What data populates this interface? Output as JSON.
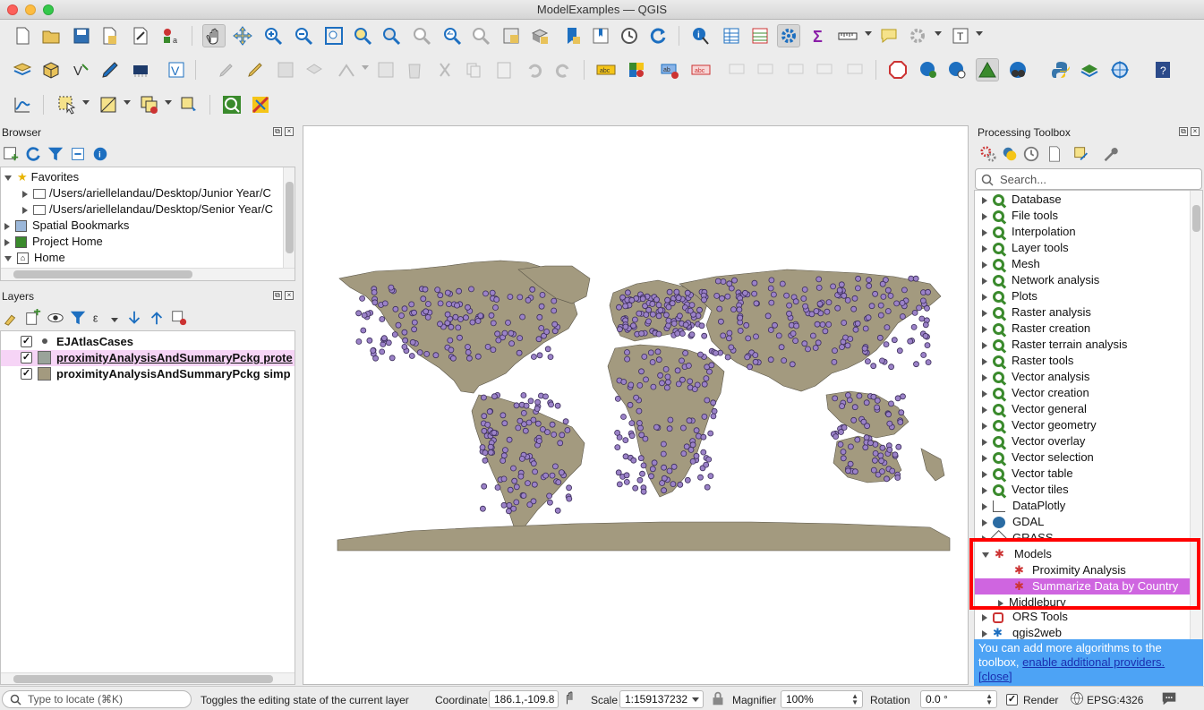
{
  "window": {
    "title": "ModelExamples — QGIS"
  },
  "colors": {
    "selection": "#cf65e0",
    "ocean": "#ffffff",
    "land": "#a39a7f",
    "point": "#9b82c8",
    "highlight_box": "#ff0000",
    "tip_bg": "#4da3f5"
  },
  "browser": {
    "title": "Browser",
    "items": [
      {
        "label": "Favorites",
        "expanded": true,
        "icon": "star-icon"
      },
      {
        "label": "/Users/ariellelandau/Desktop/Junior Year/C",
        "icon": "folder-icon"
      },
      {
        "label": "/Users/ariellelandau/Desktop/Senior Year/C",
        "icon": "folder-icon"
      },
      {
        "label": "Spatial Bookmarks",
        "icon": "bookmark-icon"
      },
      {
        "label": "Project Home",
        "icon": "project-home-icon"
      },
      {
        "label": "Home",
        "icon": "home-icon"
      }
    ]
  },
  "layers": {
    "title": "Layers",
    "items": [
      {
        "label": "EJAtlasCases",
        "checked": true
      },
      {
        "label": "proximityAnalysisAndSummaryPckg prote",
        "checked": true
      },
      {
        "label": "proximityAnalysisAndSummaryPckg simp",
        "checked": true
      }
    ]
  },
  "toolbox": {
    "title": "Processing Toolbox",
    "search_placeholder": "Search...",
    "providers": [
      "Database",
      "File tools",
      "Interpolation",
      "Layer tools",
      "Mesh",
      "Network analysis",
      "Plots",
      "Raster analysis",
      "Raster creation",
      "Raster terrain analysis",
      "Raster tools",
      "Vector analysis",
      "Vector creation",
      "Vector general",
      "Vector geometry",
      "Vector overlay",
      "Vector selection",
      "Vector table",
      "Vector tiles"
    ],
    "dataplotly": "DataPlotly",
    "gdal": "GDAL",
    "grass": "GRASS",
    "models": "Models",
    "model_items": [
      "Proximity Analysis",
      "Summarize Data by Country"
    ],
    "middlebury": "Middlebury",
    "ors": "ORS Tools",
    "qgis2web": "qgis2web",
    "tip_text": "You can add more algorithms to the toolbox,",
    "tip_link": "enable additional providers.",
    "tip_close": "[close]"
  },
  "statusbar": {
    "locate_placeholder": "Type to locate (⌘K)",
    "message": "Toggles the editing state of the current layer",
    "coordinate_label": "Coordinate",
    "coordinate_value": "186.1,-109.8",
    "scale_label": "Scale",
    "scale_value": "1:159137232",
    "magnifier_label": "Magnifier",
    "magnifier_value": "100%",
    "rotation_label": "Rotation",
    "rotation_value": "0.0 °",
    "render_label": "Render",
    "crs": "EPSG:4326"
  }
}
